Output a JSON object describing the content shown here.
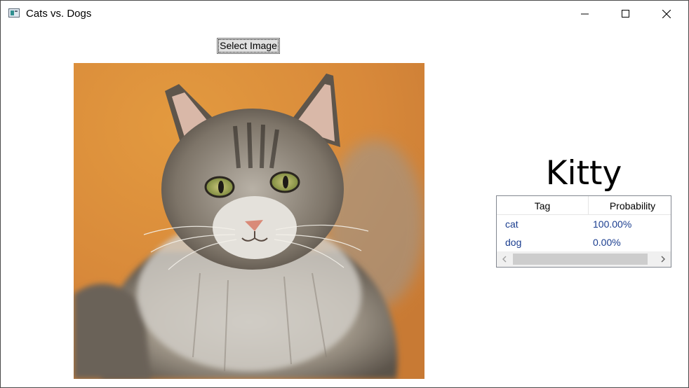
{
  "window": {
    "title": "Cats vs. Dogs",
    "icons": {
      "app": "app-window-icon",
      "minimize": "minimize-icon",
      "maximize": "maximize-icon",
      "close": "close-icon"
    }
  },
  "toolbar": {
    "select_label": "Select Image"
  },
  "photo": {
    "subject": "cat-photo",
    "background_color": "#d98e34"
  },
  "result": {
    "label": "Kitty"
  },
  "grid": {
    "columns": [
      "Tag",
      "Probability"
    ],
    "rows": [
      {
        "tag": "cat",
        "probability": "100.00%"
      },
      {
        "tag": "dog",
        "probability": "0.00%"
      }
    ],
    "scrollbar_icons": {
      "left": "chevron-left-icon",
      "right": "chevron-right-icon"
    }
  },
  "colors": {
    "cell_text": "#1a3d8f",
    "button_face": "#e1e1e1",
    "grid_border": "#828790"
  }
}
